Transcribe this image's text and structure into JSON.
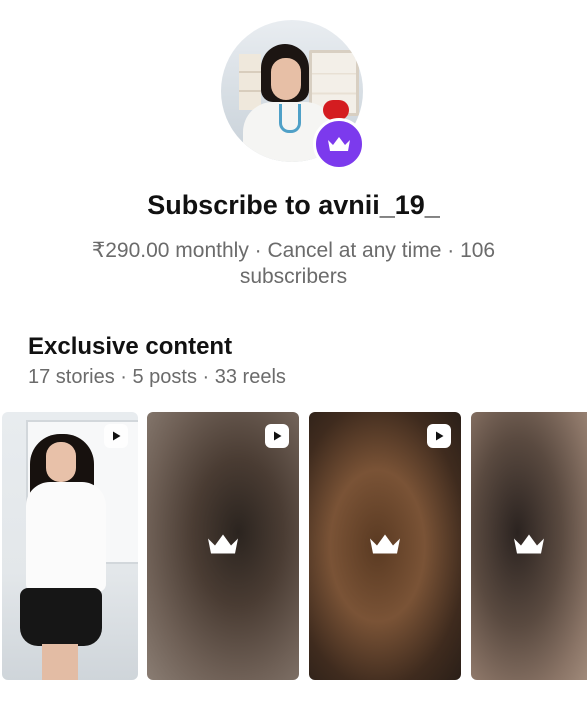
{
  "header": {
    "title": "Subscribe to avnii_19_",
    "subtitle": "₹290.00 monthly · Cancel at any time · 106 subscribers"
  },
  "exclusive": {
    "title": "Exclusive content",
    "meta": "17 stories · 5 posts · 33 reels"
  },
  "tiles": [
    {
      "type": "reel",
      "locked": false,
      "icon": "play-icon"
    },
    {
      "type": "reel",
      "locked": true,
      "icon": "play-icon"
    },
    {
      "type": "reel",
      "locked": true,
      "icon": "play-icon"
    },
    {
      "type": "post",
      "locked": true,
      "icon": "crown-icon"
    }
  ],
  "colors": {
    "accent": "#7c3aed",
    "text_primary": "#111111",
    "text_secondary": "#6b6b6b"
  }
}
